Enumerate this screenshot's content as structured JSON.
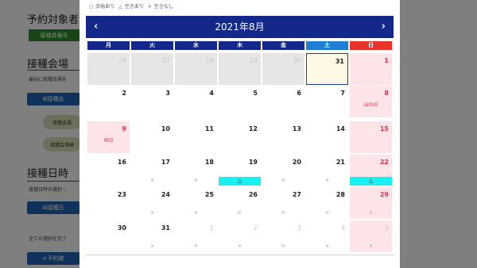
{
  "background": {
    "heading1": "予約対象者",
    "button_green": "接種券番号",
    "heading2": "接種会場",
    "text1": "最初に接種会場を",
    "button_venue": "⊞接種会",
    "pill1": "接種会場",
    "pill2": "接種会場検",
    "heading3": "接種日時",
    "text2": "接種日時の選択・",
    "button_date": "⊞接種日",
    "text3": "全ての選択を完了",
    "button_reserve": "✔予約確"
  },
  "legend": [
    {
      "symbol": "○",
      "label": "余裕あり"
    },
    {
      "symbol": "△",
      "label": "空きあり"
    },
    {
      "symbol": "×",
      "label": "空きなし"
    }
  ],
  "calendar": {
    "title": "2021年8月",
    "prev_icon": "‹",
    "next_icon": "›",
    "weekdays": [
      "月",
      "火",
      "水",
      "木",
      "金",
      "土",
      "日"
    ],
    "weekday_colors": [
      "#13288a",
      "#13288a",
      "#13288a",
      "#13288a",
      "#13288a",
      "#1e7fd2",
      "#e8332a"
    ],
    "colors": {
      "holiday_bg": "#fde4e8",
      "holiday_text": "#e0334a",
      "other_month_bg": "#e6e6e6",
      "today_bg": "#fdf8e3",
      "available_bar": "#19f0f0",
      "header_bg": "#13288a"
    },
    "weeks": [
      [
        {
          "day": "26",
          "type": "other"
        },
        {
          "day": "27",
          "type": "other"
        },
        {
          "day": "28",
          "type": "other"
        },
        {
          "day": "29",
          "type": "other"
        },
        {
          "day": "30",
          "type": "other"
        },
        {
          "day": "31",
          "type": "today"
        },
        {
          "day": "1",
          "type": "hol"
        }
      ],
      [
        {
          "day": "2"
        },
        {
          "day": "3"
        },
        {
          "day": "4"
        },
        {
          "day": "5"
        },
        {
          "day": "6"
        },
        {
          "day": "7"
        },
        {
          "day": "8",
          "type": "hol",
          "holiday": "山の日"
        }
      ],
      [
        {
          "day": "9",
          "type": "hol",
          "holiday": "休日"
        },
        {
          "day": "10"
        },
        {
          "day": "11"
        },
        {
          "day": "12"
        },
        {
          "day": "13"
        },
        {
          "day": "14"
        },
        {
          "day": "15",
          "type": "hol"
        }
      ],
      [
        {
          "day": "16"
        },
        {
          "day": "17",
          "status": "×"
        },
        {
          "day": "18",
          "status": "×"
        },
        {
          "day": "19",
          "avail": "△"
        },
        {
          "day": "20",
          "status": "×"
        },
        {
          "day": "21",
          "status": "×"
        },
        {
          "day": "22",
          "type": "hol",
          "avail": "△"
        }
      ],
      [
        {
          "day": "23"
        },
        {
          "day": "24",
          "status": "×"
        },
        {
          "day": "25",
          "status": "×"
        },
        {
          "day": "26",
          "status": "×"
        },
        {
          "day": "27",
          "status": "×"
        },
        {
          "day": "28",
          "status": "×"
        },
        {
          "day": "29",
          "type": "hol",
          "status": "×"
        }
      ],
      [
        {
          "day": "30"
        },
        {
          "day": "31",
          "status": "×"
        },
        {
          "day": "1",
          "type": "out",
          "status": "×"
        },
        {
          "day": "2",
          "type": "out",
          "status": "×"
        },
        {
          "day": "3",
          "type": "out",
          "status": "×"
        },
        {
          "day": "4",
          "type": "out",
          "status": "×"
        },
        {
          "day": "5",
          "type": "holout",
          "status": "×"
        }
      ]
    ]
  }
}
